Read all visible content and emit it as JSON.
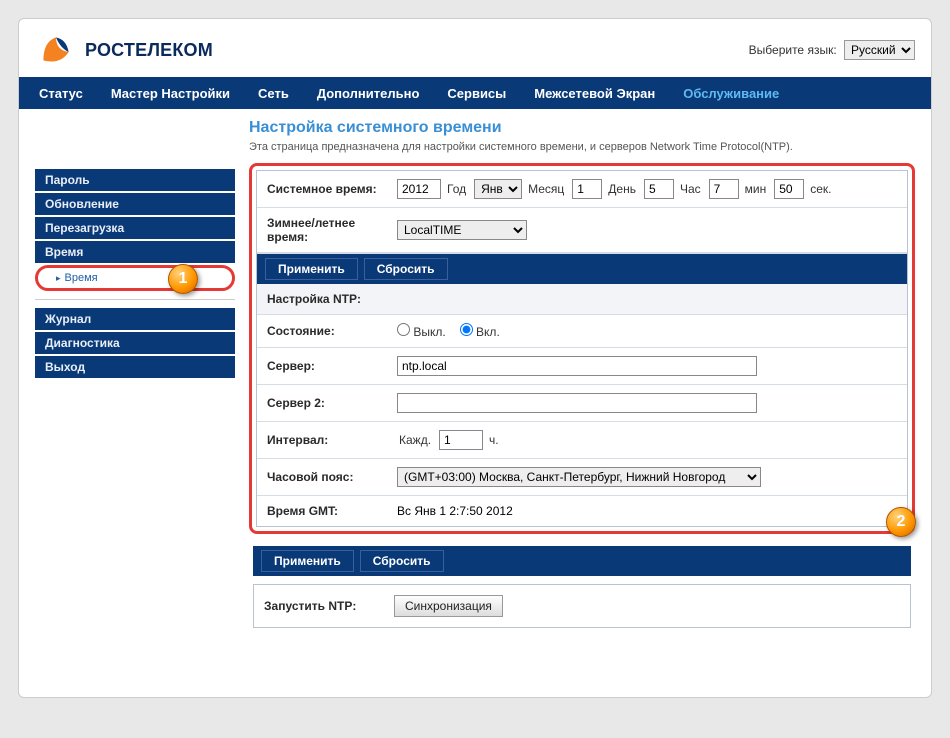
{
  "lang": {
    "label": "Выберите язык:",
    "value": "Русский"
  },
  "logo_text": "РОСТЕЛЕКОМ",
  "nav": {
    "status": "Статус",
    "wizard": "Мастер Настройки",
    "network": "Сеть",
    "advanced": "Дополнительно",
    "services": "Сервисы",
    "firewall": "Межсетевой Экран",
    "maintenance": "Обслуживание"
  },
  "sidebar": {
    "password": "Пароль",
    "update": "Обновление",
    "reboot": "Перезагрузка",
    "time": "Время",
    "time_sub": "Время",
    "log": "Журнал",
    "diag": "Диагностика",
    "exit": "Выход"
  },
  "badge1": "1",
  "badge2": "2",
  "page": {
    "title": "Настройка системного времени",
    "desc": "Эта страница предназначена для настройки системного времени, и серверов Network Time Protocol(NTP)."
  },
  "time": {
    "label": "Системное время:",
    "year_val": "2012",
    "year_unit": "Год",
    "month_val": "Янв",
    "month_unit": "Месяц",
    "day_val": "1",
    "day_unit": "День",
    "hour_val": "5",
    "hour_unit": "Час",
    "min_val": "7",
    "min_unit": "мин",
    "sec_val": "50",
    "sec_unit": "сек."
  },
  "dst": {
    "label": "Зимнее/летнее время:",
    "value": "LocalTIME"
  },
  "btn_apply": "Применить",
  "btn_reset": "Сбросить",
  "ntp": {
    "title": "Настройка NTP:",
    "state_label": "Состояние:",
    "state_off": "Выкл.",
    "state_on": "Вкл.",
    "server_label": "Сервер:",
    "server_val": "ntp.local",
    "server2_label": "Сервер 2:",
    "server2_val": "",
    "interval_label": "Интервал:",
    "interval_prefix": "Кажд.",
    "interval_val": "1",
    "interval_suffix": "ч.",
    "tz_label": "Часовой пояс:",
    "tz_val": "(GMT+03:00) Москва, Санкт-Петербург, Нижний Новгород",
    "gmt_label": "Время GMT:",
    "gmt_val": "Вс Янв 1 2:7:50 2012"
  },
  "sync": {
    "label": "Запустить NTP:",
    "button": "Синхронизация"
  }
}
